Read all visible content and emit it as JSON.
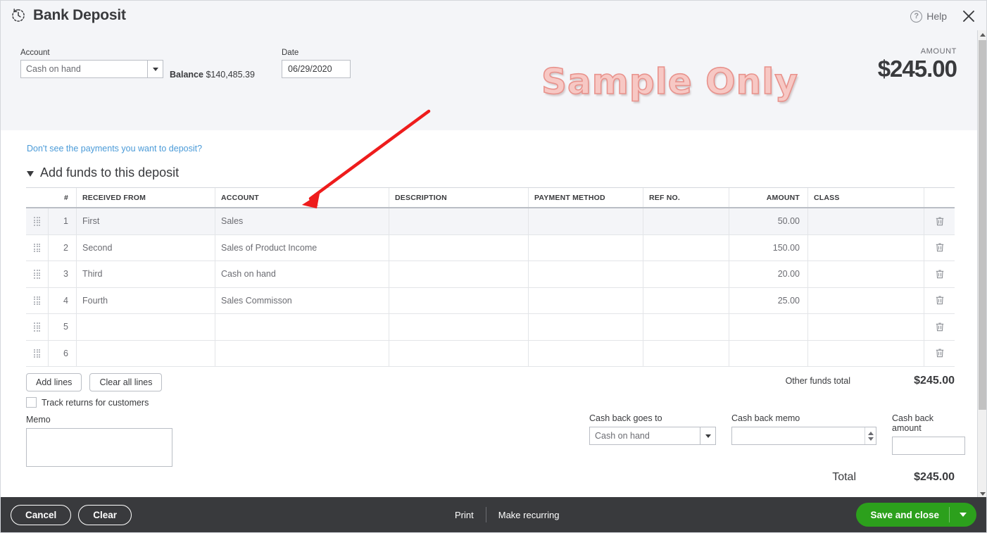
{
  "window": {
    "title": "Bank Deposit",
    "title_icon": "recurring-clock-icon",
    "help_label": "Help",
    "help_glyph": "?",
    "close_glyph": "✕"
  },
  "watermark": {
    "text": "Sample Only",
    "color": "#f7c8c4",
    "stroke": "#e8928c"
  },
  "header": {
    "account_label": "Account",
    "account_value": "Cash on hand",
    "balance_prefix": "Balance",
    "balance_value": "$140,485.39",
    "date_label": "Date",
    "date_value": "06/29/2020",
    "amount_label": "AMOUNT",
    "amount_value": "$245.00"
  },
  "body": {
    "hint_link": "Don't see the payments you want to deposit?",
    "section_title": "Add funds to this deposit"
  },
  "grid": {
    "columns": [
      {
        "key": "num",
        "label": "#"
      },
      {
        "key": "received_from",
        "label": "RECEIVED FROM"
      },
      {
        "key": "account",
        "label": "ACCOUNT"
      },
      {
        "key": "description",
        "label": "DESCRIPTION"
      },
      {
        "key": "payment_method",
        "label": "PAYMENT METHOD"
      },
      {
        "key": "ref_no",
        "label": "REF NO."
      },
      {
        "key": "amount",
        "label": "AMOUNT"
      },
      {
        "key": "class",
        "label": "CLASS"
      }
    ],
    "rows": [
      {
        "num": "1",
        "received_from": "First",
        "account": "Sales",
        "description": "",
        "payment_method": "",
        "ref_no": "",
        "amount": "50.00",
        "class": "",
        "selected": true
      },
      {
        "num": "2",
        "received_from": "Second",
        "account": "Sales of Product Income",
        "description": "",
        "payment_method": "",
        "ref_no": "",
        "amount": "150.00",
        "class": "",
        "selected": false
      },
      {
        "num": "3",
        "received_from": "Third",
        "account": "Cash on hand",
        "description": "",
        "payment_method": "",
        "ref_no": "",
        "amount": "20.00",
        "class": "",
        "selected": false
      },
      {
        "num": "4",
        "received_from": "Fourth",
        "account": "Sales Commisson",
        "description": "",
        "payment_method": "",
        "ref_no": "",
        "amount": "25.00",
        "class": "",
        "selected": false
      },
      {
        "num": "5",
        "received_from": "",
        "account": "",
        "description": "",
        "payment_method": "",
        "ref_no": "",
        "amount": "",
        "class": "",
        "selected": false
      },
      {
        "num": "6",
        "received_from": "",
        "account": "",
        "description": "",
        "payment_method": "",
        "ref_no": "",
        "amount": "",
        "class": "",
        "selected": false
      }
    ]
  },
  "actions": {
    "add_lines": "Add lines",
    "clear_all_lines": "Clear all lines",
    "track_returns_label": "Track returns for customers",
    "track_returns_checked": false
  },
  "totals": {
    "other_funds_label": "Other funds total",
    "other_funds_value": "$245.00",
    "total_label": "Total",
    "total_value": "$245.00"
  },
  "memo": {
    "label": "Memo",
    "value": ""
  },
  "cash_back": {
    "goes_to_label": "Cash back goes to",
    "goes_to_value": "Cash on hand",
    "memo_label": "Cash back memo",
    "memo_value": "",
    "amount_label": "Cash back amount",
    "amount_value": ""
  },
  "footer": {
    "cancel": "Cancel",
    "clear": "Clear",
    "print": "Print",
    "make_recurring": "Make recurring",
    "save_and_close": "Save and close",
    "save_color": "#2ca01c"
  },
  "annotation": {
    "arrow_color": "#ee1c1c"
  }
}
